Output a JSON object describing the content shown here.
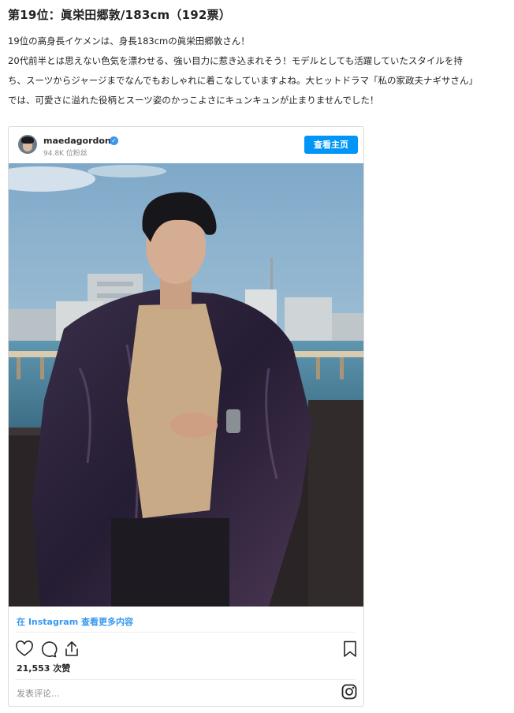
{
  "heading": "第19位：眞栄田郷敦/183cm（192票）",
  "article": {
    "lines": [
      "19位の高身長イケメンは、身長183cmの眞栄田郷敦さん！",
      "20代前半とは思えない色気を漂わせる、強い目力に惹き込まれそう！モデルとしても活躍していたスタイルを持",
      "ち、スーツからジャージまでなんでもおしゃれに着こなしていますよね。大ヒットドラマ「私の家政夫ナギサさん」",
      "では、可愛さに溢れた役柄とスーツ姿のかっこよさにキュンキュンが止まりませんでした！"
    ]
  },
  "instagram": {
    "username": "maedagordon",
    "verified_mark": "✓",
    "followers": "94.8K 位粉丝",
    "follow_button": "查看主页",
    "view_more": "在 Instagram 查看更多内容",
    "likes": "21,553 次赞",
    "comment_placeholder": "发表评论...",
    "icons": [
      "heart-icon",
      "comment-icon",
      "share-icon",
      "bookmark-icon",
      "instagram-logo-icon"
    ],
    "colors": {
      "accent": "#0095f6",
      "link": "#3897f0",
      "border": "#dbdbdb"
    }
  }
}
